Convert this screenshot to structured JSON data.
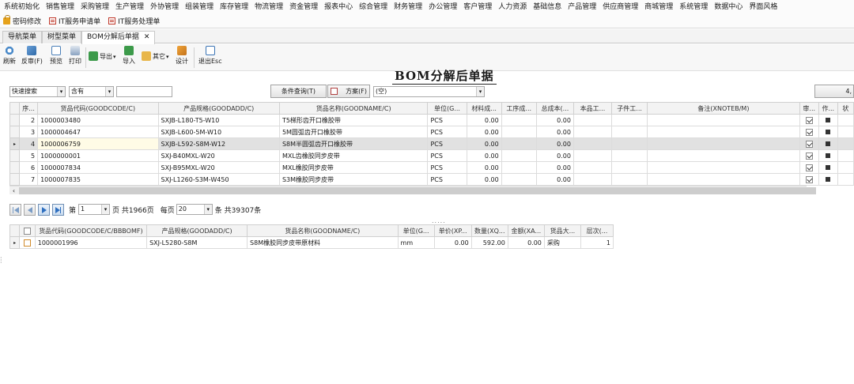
{
  "menu": [
    "系统初始化",
    "销售管理",
    "采购管理",
    "生产管理",
    "外协管理",
    "组装管理",
    "库存管理",
    "物流管理",
    "资金管理",
    "报表中心",
    "综合管理",
    "财务管理",
    "办公管理",
    "客户管理",
    "人力资源",
    "基础信息",
    "产品管理",
    "供应商管理",
    "商城管理",
    "系统管理",
    "数据中心",
    "界面风格"
  ],
  "quicklinks": [
    {
      "icon": "lock-icon",
      "label": "密码修改"
    },
    {
      "icon": "form-icon",
      "label": "IT服务申请单"
    },
    {
      "icon": "form-icon",
      "label": "IT服务处理单"
    }
  ],
  "tabs": [
    {
      "label": "导航菜单"
    },
    {
      "label": "树型菜单"
    },
    {
      "label": "BOM分解后单据",
      "close": "✕"
    }
  ],
  "toolbar": {
    "refresh": "刷新",
    "unaudit": "反审(F)",
    "preview": "预览",
    "print": "打印",
    "export": "导出",
    "import": "导入",
    "other": "其它",
    "design": "设计",
    "exit": "退出Esc"
  },
  "title": "BOM分解后单据",
  "search": {
    "mode": "快速搜索",
    "op": "含有",
    "value": "",
    "condition_btn": "条件查询(T)",
    "scheme_btn": "方案(F)",
    "scheme_value": "(空)",
    "right_value": "4,"
  },
  "main_grid": {
    "headers": [
      "序...",
      "货品代码(GOODCODE/C)",
      "产品规格(GOODADD/C)",
      "货品名称(GOODNAME/C)",
      "单位(G...",
      "材料成...",
      "工序成...",
      "总成本(...",
      "本品工...",
      "子件工...",
      "备注(XNOTEB/M)",
      "审...",
      "作...",
      "状"
    ],
    "rows": [
      {
        "seq": "2",
        "code": "1000003480",
        "spec": "SXJB-L180-T5-W10",
        "name": "T5梯形齿开口橡胶带",
        "unit": "PCS",
        "mat": "0.00",
        "proc": "",
        "total": "0.00",
        "audit": true,
        "op": true
      },
      {
        "seq": "3",
        "code": "1000004647",
        "spec": "SXJB-L600-5M-W10",
        "name": "5M圆弧齿开口橡胶带",
        "unit": "PCS",
        "mat": "0.00",
        "proc": "",
        "total": "0.00",
        "audit": true,
        "op": true
      },
      {
        "seq": "4",
        "code": "1000006759",
        "spec": "SXJB-L592-S8M-W12",
        "name": "S8M半圆弧齿开口橡胶带",
        "unit": "PCS",
        "mat": "0.00",
        "proc": "",
        "total": "0.00",
        "audit": true,
        "op": true,
        "selected": true
      },
      {
        "seq": "5",
        "code": "1000000001",
        "spec": "SXJ-B40MXL-W20",
        "name": "MXL齿橡胶同步皮带",
        "unit": "PCS",
        "mat": "0.00",
        "proc": "",
        "total": "0.00",
        "audit": true,
        "op": true
      },
      {
        "seq": "6",
        "code": "1000007834",
        "spec": "SXJ-B95MXL-W20",
        "name": "MXL橡胶同步皮带",
        "unit": "PCS",
        "mat": "0.00",
        "proc": "",
        "total": "0.00",
        "audit": true,
        "op": true
      },
      {
        "seq": "7",
        "code": "1000007835",
        "spec": "SXJ-L1260-S3M-W450",
        "name": "S3M橡胶同步皮带",
        "unit": "PCS",
        "mat": "0.00",
        "proc": "",
        "total": "0.00",
        "audit": true,
        "op": true
      }
    ]
  },
  "pager": {
    "page_label": "第",
    "page": "1",
    "pages_text": "页 共1966页",
    "per_label": "每页",
    "per": "20",
    "records_text": "条 共39307条"
  },
  "detail_grid": {
    "headers": [
      "货品代码(GOODCODE/C/BBBOMF)",
      "产品规格(GOODADD/C)",
      "货品名称(GOODNAME/C)",
      "单位(G...",
      "单价(XP...",
      "数量(XQ...",
      "金额(XA...",
      "货品大...",
      "层次(..."
    ],
    "rows": [
      {
        "code": "1000001996",
        "spec": "SXJ-L5280-S8M",
        "name": "S8M橡胶同步皮带原材料",
        "unit": "mm",
        "price": "0.00",
        "qty": "592.00",
        "amount": "0.00",
        "category": "采购",
        "level": "1"
      }
    ]
  }
}
